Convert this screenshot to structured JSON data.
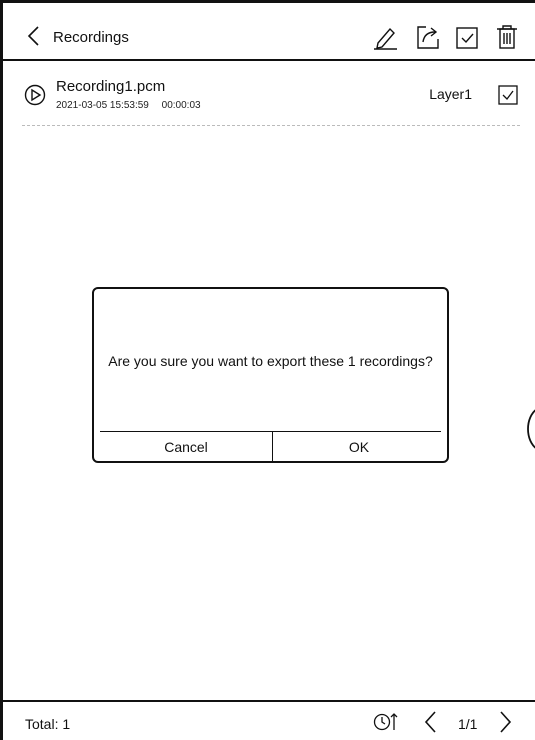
{
  "header": {
    "title": "Recordings",
    "icons": [
      "back-chevron-icon",
      "pencil-icon",
      "export-icon",
      "select-all-checkbox-icon",
      "trash-icon"
    ]
  },
  "recording": {
    "name": "Recording1.pcm",
    "datetime": "2021-03-05 15:53:59",
    "duration": "00:00:03",
    "layer": "Layer1",
    "checked": true
  },
  "dialog": {
    "message": "Are you sure you want to export these 1 recordings?",
    "cancel_label": "Cancel",
    "ok_label": "OK"
  },
  "footer": {
    "total_label": "Total:  1",
    "page": "1/1"
  }
}
